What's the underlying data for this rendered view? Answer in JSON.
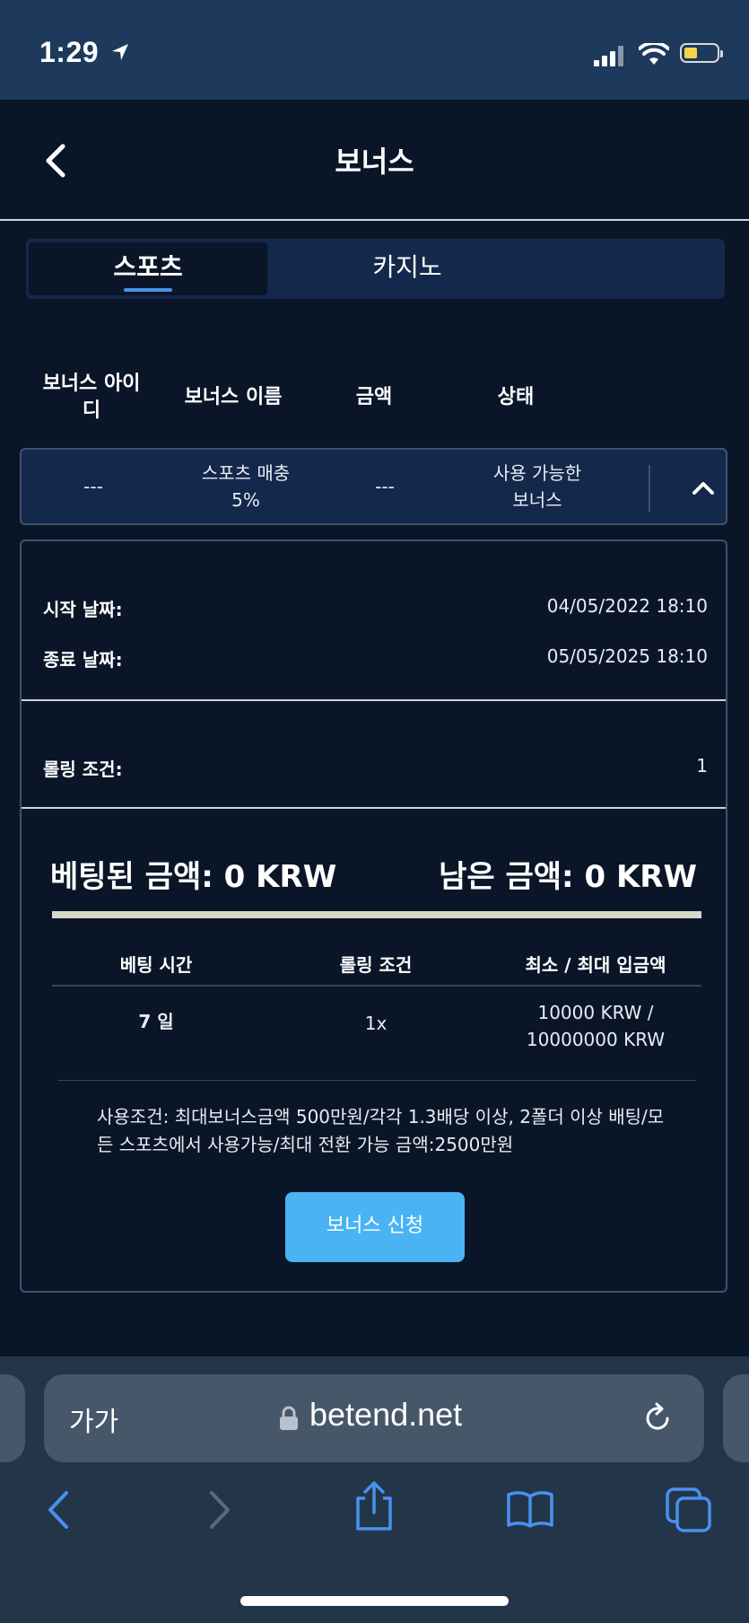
{
  "status_bar": {
    "time": "1:29"
  },
  "header": {
    "title": "보너스"
  },
  "tabs": [
    {
      "label": "스포츠",
      "active": true
    },
    {
      "label": "카지노",
      "active": false
    }
  ],
  "table": {
    "columns": [
      "보너스 아이\n디",
      "보너스 이름",
      "금액",
      "상태"
    ],
    "row": {
      "id": "---",
      "name": "스포츠 매충\n5%",
      "amount": "---",
      "status": "사용 가능한\n보너스"
    }
  },
  "detail": {
    "start_label": "시작 날짜:",
    "start_value": "04/05/2022 18:10",
    "end_label": "종료 날짜:",
    "end_value": "05/05/2025 18:10",
    "rolling_label": "롤링 조건:",
    "rolling_value": "1",
    "bet_amount": "베팅된 금액: 0 KRW",
    "remaining_amount": "남은 금액: 0 KRW",
    "wagering_progress": 0,
    "sub_table": {
      "headers": [
        "베팅 시간",
        "롤링 조건",
        "최소 / 최대 입금액"
      ],
      "values": [
        "7 일",
        "1x",
        "10000 KRW /\n10000000 KRW"
      ]
    },
    "usage_note": "사용조건: 최대보너스금액 500만원/각각 1.3배당 이상, 2폴더 이상 배팅/모든 스포츠에서 사용가능/최대 전환 가능 금액:2500만원",
    "apply_button": "보너스 신청"
  },
  "browser": {
    "text_size_label": "가가",
    "url": "betend.net"
  },
  "colors": {
    "background": "#0a1628",
    "status_bar": "#1d3a5c",
    "card": "#13284a",
    "accent": "#4ab3f4",
    "tab_indicator": "#4a90e2",
    "safari_toolbar": "#233649"
  },
  "icons": [
    "location-arrow-icon",
    "signal-icon",
    "wifi-icon",
    "battery-icon",
    "back-chevron-icon",
    "chevron-up-icon",
    "lock-icon",
    "reload-icon",
    "safari-back-icon",
    "safari-forward-icon",
    "share-icon",
    "bookmarks-icon",
    "tabs-icon"
  ]
}
